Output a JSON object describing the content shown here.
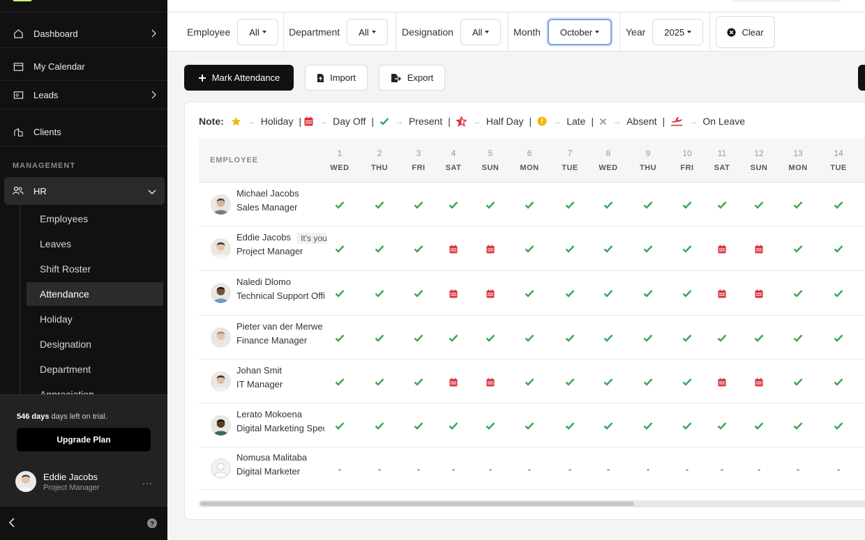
{
  "colors": {
    "sidebar_bg": "#111111",
    "present": "#3aa655",
    "dayoff": "#d9363e",
    "halfday": "#d9363e",
    "late": "#f4b400",
    "absent": "#9a9a9a",
    "accent_focus": "#7da0e0"
  },
  "sidebar": {
    "items": [
      {
        "label": "Dashboard",
        "icon": "home-icon",
        "has_chevron": true
      },
      {
        "label": "My Calendar",
        "icon": "calendar-icon",
        "has_chevron": false
      },
      {
        "label": "Leads",
        "icon": "id-card-icon",
        "has_chevron": true
      },
      {
        "label": "Clients",
        "icon": "building-icon",
        "has_chevron": false
      }
    ],
    "section_label": "MANAGEMENT",
    "hr_label": "HR",
    "sub_items": [
      {
        "label": "Employees",
        "active": false
      },
      {
        "label": "Leaves",
        "active": false
      },
      {
        "label": "Shift Roster",
        "active": false
      },
      {
        "label": "Attendance",
        "active": true
      },
      {
        "label": "Holiday",
        "active": false
      },
      {
        "label": "Designation",
        "active": false
      },
      {
        "label": "Department",
        "active": false
      },
      {
        "label": "Appreciation",
        "active": false
      }
    ],
    "trial_days": "546 days",
    "trial_text": " days left on trial.",
    "upgrade_label": "Upgrade Plan",
    "user": {
      "name": "Eddie Jacobs",
      "role": "Project Manager",
      "more": "..."
    }
  },
  "filters": {
    "employee_label": "Employee",
    "employee_value": "All",
    "department_label": "Department",
    "department_value": "All",
    "designation_label": "Designation",
    "designation_value": "All",
    "month_label": "Month",
    "month_value": "October",
    "year_label": "Year",
    "year_value": "2025",
    "clear_label": "Clear"
  },
  "actions": {
    "mark_attendance": "Mark Attendance",
    "import": "Import",
    "export": "Export"
  },
  "legend": {
    "note_label": "Note:",
    "items": [
      {
        "icon": "star-icon",
        "label": "Holiday"
      },
      {
        "icon": "calendar-dayoff-icon",
        "label": "Day Off"
      },
      {
        "icon": "check-icon",
        "label": "Present"
      },
      {
        "icon": "half-star-icon",
        "label": "Half Day"
      },
      {
        "icon": "late-clock-icon",
        "label": "Late"
      },
      {
        "icon": "cross-icon",
        "label": "Absent"
      },
      {
        "icon": "plane-icon",
        "label": "On Leave"
      }
    ]
  },
  "table": {
    "employee_header": "EMPLOYEE",
    "days": [
      {
        "num": "1",
        "dow": "WED"
      },
      {
        "num": "2",
        "dow": "THU"
      },
      {
        "num": "3",
        "dow": "FRI"
      },
      {
        "num": "4",
        "dow": "SAT"
      },
      {
        "num": "5",
        "dow": "SUN"
      },
      {
        "num": "6",
        "dow": "MON"
      },
      {
        "num": "7",
        "dow": "TUE"
      },
      {
        "num": "8",
        "dow": "WED"
      },
      {
        "num": "9",
        "dow": "THU"
      },
      {
        "num": "10",
        "dow": "FRI"
      },
      {
        "num": "11",
        "dow": "SAT"
      },
      {
        "num": "12",
        "dow": "SUN"
      },
      {
        "num": "13",
        "dow": "MON"
      },
      {
        "num": "14",
        "dow": "TUE"
      }
    ],
    "rows": [
      {
        "name": "Michael Jacobs",
        "role": "Sales Manager",
        "badge": "",
        "status": [
          "P",
          "P",
          "P",
          "P",
          "P",
          "P",
          "P",
          "P",
          "P",
          "P",
          "P",
          "P",
          "P",
          "P"
        ]
      },
      {
        "name": "Eddie Jacobs",
        "role": "Project Manager",
        "badge": "It's you",
        "status": [
          "P",
          "P",
          "P",
          "D",
          "D",
          "P",
          "P",
          "P",
          "P",
          "P",
          "D",
          "D",
          "P",
          "P"
        ]
      },
      {
        "name": "Naledi Dlomo",
        "role": "Technical Support Officer",
        "badge": "",
        "status": [
          "P",
          "P",
          "P",
          "D",
          "D",
          "P",
          "P",
          "P",
          "P",
          "P",
          "D",
          "D",
          "P",
          "P"
        ]
      },
      {
        "name": "Pieter van der Merwe",
        "role": "Finance Manager",
        "badge": "",
        "status": [
          "P",
          "P",
          "P",
          "P",
          "P",
          "P",
          "P",
          "P",
          "P",
          "P",
          "P",
          "P",
          "P",
          "P"
        ]
      },
      {
        "name": "Johan Smit",
        "role": "IT Manager",
        "badge": "",
        "status": [
          "P",
          "P",
          "P",
          "D",
          "D",
          "P",
          "P",
          "P",
          "P",
          "P",
          "D",
          "D",
          "P",
          "P"
        ]
      },
      {
        "name": "Lerato Mokoena",
        "role": "Digital Marketing Specialist",
        "badge": "",
        "status": [
          "P",
          "P",
          "P",
          "P",
          "P",
          "P",
          "P",
          "P",
          "P",
          "P",
          "P",
          "P",
          "P",
          "P"
        ]
      },
      {
        "name": "Nomusa Malitaba",
        "role": "Digital Marketer",
        "badge": "",
        "status": [
          "-",
          "-",
          "-",
          "-",
          "-",
          "-",
          "-",
          "-",
          "-",
          "-",
          "-",
          "-",
          "-",
          "-"
        ]
      }
    ]
  }
}
